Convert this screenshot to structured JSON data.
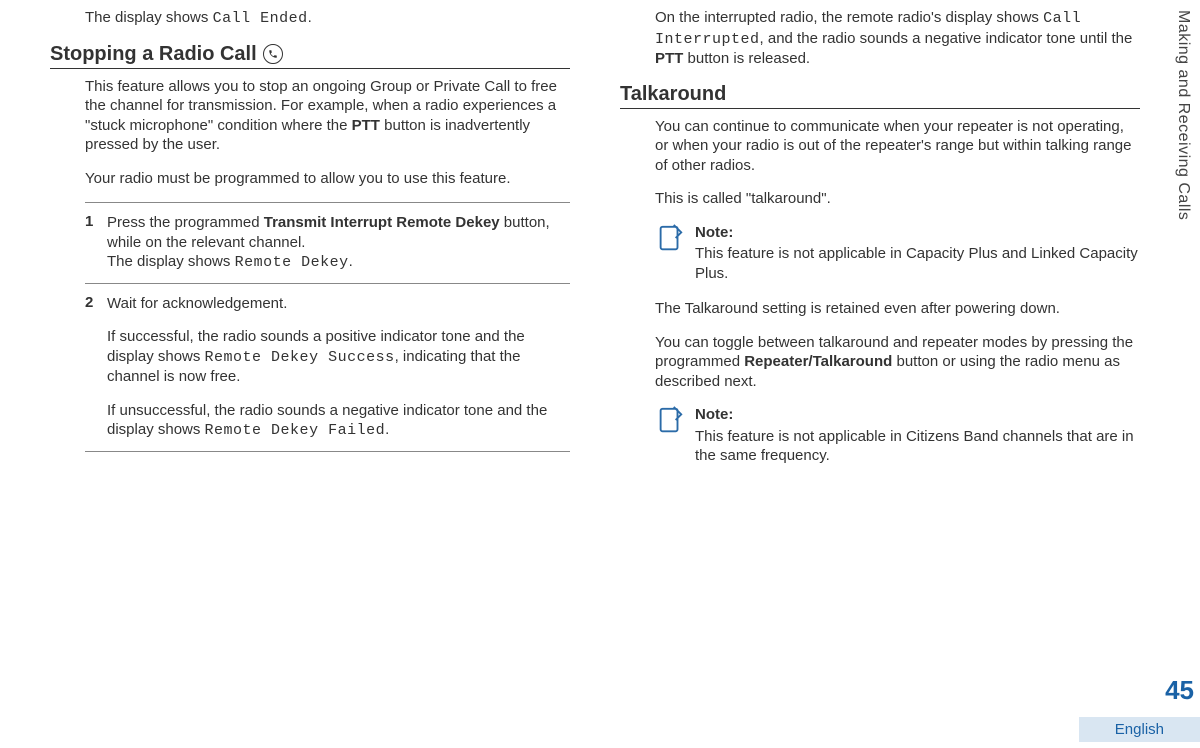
{
  "side_tab": "Making and Receiving Calls",
  "page_number": "45",
  "language": "English",
  "left": {
    "intro_line_pre": "The display shows ",
    "intro_line_code": "Call Ended",
    "intro_line_post": ".",
    "h_stop": "Stopping a Radio Call",
    "stop_p1_a": "This feature allows you to stop an ongoing Group or Private Call to free the channel for transmission. For example, when a radio experiences a \"stuck microphone\" condition where the ",
    "stop_p1_b": "PTT",
    "stop_p1_c": " button is inadvertently pressed by the user.",
    "stop_p2": "Your radio must be programmed to allow you to use this feature.",
    "step1_a": "Press the programmed ",
    "step1_b": "Transmit Interrupt Remote Dekey",
    "step1_c": " button, while on the relevant channel.",
    "step1_d": "The display shows ",
    "step1_code": "Remote Dekey",
    "step1_e": ".",
    "step2_lead": "Wait for acknowledgement.",
    "step2_p1_a": "If successful, the radio sounds a positive indicator tone and the display shows ",
    "step2_p1_code": "Remote Dekey Success",
    "step2_p1_b": ", indicating that the channel is now free.",
    "step2_p2_a": "If unsuccessful, the radio sounds a negative indicator tone and the display shows ",
    "step2_p2_code": "Remote Dekey Failed",
    "step2_p2_b": "."
  },
  "right": {
    "intro_a": "On the interrupted radio, the remote radio's display shows ",
    "intro_code": "Call Interrupted",
    "intro_b": ", and the radio sounds a negative indicator tone until the ",
    "intro_c": "PTT",
    "intro_d": " button is released.",
    "h_talk": "Talkaround",
    "talk_p1": "You can continue to communicate when your repeater is not operating, or when your radio is out of the repeater's range but within talking range of other radios.",
    "talk_p2": "This is called \"talkaround\".",
    "note_label": "Note:",
    "note1_body": "This feature is not applicable in Capacity Plus and Linked Capacity Plus.",
    "talk_p3": "The Talkaround setting is retained even after powering down.",
    "talk_p4_a": "You can toggle between talkaround and repeater modes by pressing the programmed ",
    "talk_p4_b": "Repeater/Talkaround",
    "talk_p4_c": " button or using the radio menu as described next.",
    "note2_body": "This feature is not applicable in Citizens Band channels that are in the same frequency."
  }
}
